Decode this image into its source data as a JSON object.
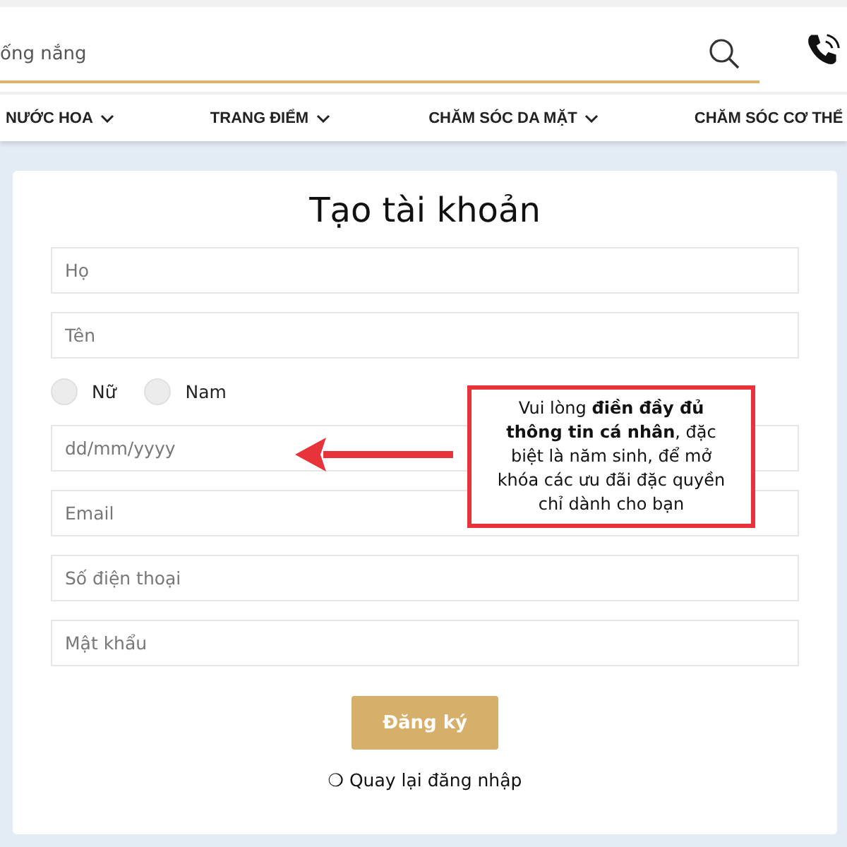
{
  "search": {
    "value": "ống nắng"
  },
  "nav": [
    {
      "label": "NƯỚC HOA",
      "has_dropdown": true
    },
    {
      "label": "TRANG ĐIỂM",
      "has_dropdown": true
    },
    {
      "label": "CHĂM SÓC DA MẶT",
      "has_dropdown": true
    },
    {
      "label": "CHĂM SÓC CƠ THỂ"
    }
  ],
  "form": {
    "title": "Tạo tài khoản",
    "fields": [
      {
        "kind": "text",
        "placeholder": "Họ"
      },
      {
        "kind": "text",
        "placeholder": "Tên"
      },
      {
        "kind": "gender",
        "options": [
          {
            "label": "Nữ",
            "selected": false
          },
          {
            "label": "Nam",
            "selected": false
          }
        ]
      },
      {
        "kind": "text",
        "placeholder": "dd/mm/yyyy"
      },
      {
        "kind": "text",
        "placeholder": "Email"
      },
      {
        "kind": "text",
        "placeholder": "Số điện thoại"
      },
      {
        "kind": "text",
        "placeholder": "Mật khẩu"
      }
    ],
    "submit": "Đăng ký",
    "back_link": "❍ Quay lại đăng nhập"
  },
  "callout": {
    "text": "Vui lòng **điền đầy đủ thông tin cá nhân**, đặc biệt là năm sinh, để mở khóa các ưu đãi đặc quyền chỉ dành cho bạn"
  }
}
